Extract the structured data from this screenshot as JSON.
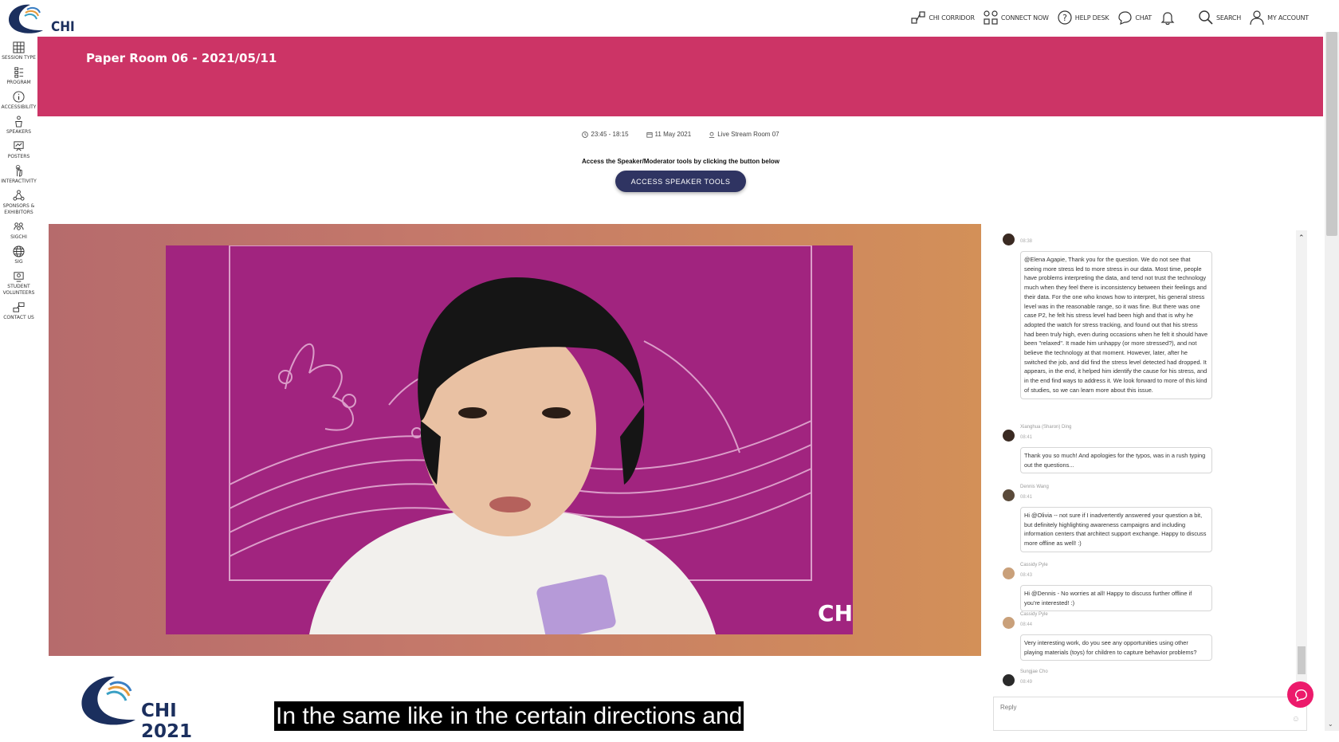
{
  "brand": {
    "logo_text": "CHI 2021"
  },
  "topnav": [
    {
      "name": "chi-corridor",
      "label": "CHI CORRIDOR",
      "icon": "corridor-icon"
    },
    {
      "name": "connect-now",
      "label": "CONNECT NOW",
      "icon": "connect-icon"
    },
    {
      "name": "help-desk",
      "label": "HELP DESK",
      "icon": "help-icon"
    },
    {
      "name": "chat",
      "label": "CHAT",
      "icon": "chat-icon"
    },
    {
      "name": "notifications",
      "label": "",
      "icon": "bell-icon"
    },
    {
      "name": "search",
      "label": "SEARCH",
      "icon": "search-icon"
    },
    {
      "name": "my-account",
      "label": "MY ACCOUNT",
      "icon": "user-icon"
    }
  ],
  "sidebar": [
    {
      "name": "session-type",
      "label": "SESSION TYPE",
      "icon": "grid-icon"
    },
    {
      "name": "program",
      "label": "PROGRAM",
      "icon": "list-icon"
    },
    {
      "name": "accessibility",
      "label": "ACCESSIBILITY",
      "icon": "info-icon"
    },
    {
      "name": "speakers",
      "label": "SPEAKERS",
      "icon": "podium-icon"
    },
    {
      "name": "posters",
      "label": "POSTERS",
      "icon": "poster-icon"
    },
    {
      "name": "interactivity",
      "label": "INTERACTIVITY",
      "icon": "hand-icon"
    },
    {
      "name": "sponsors",
      "label": "SPONSORS & EXHIBITORS",
      "icon": "network-icon"
    },
    {
      "name": "sigchi",
      "label": "SIGCHI",
      "icon": "people-icon"
    },
    {
      "name": "sig",
      "label": "SIG",
      "icon": "globe-icon"
    },
    {
      "name": "student-volunteers",
      "label": "STUDENT VOLUNTEERS",
      "icon": "volunteer-icon"
    },
    {
      "name": "contact-us",
      "label": "CONTACT US",
      "icon": "contact-icon"
    }
  ],
  "banner": {
    "title": "Paper Room 06 - 2021/05/11"
  },
  "session": {
    "time": "23:45 - 18:15",
    "date": "11 May 2021",
    "room": "Live Stream Room 07",
    "notice": "Access the Speaker/Moderator tools by clicking the button below",
    "button_label": "ACCESS SPEAKER TOOLS"
  },
  "video": {
    "brand_corner": "CH"
  },
  "caption": "In the same like in the certain directions and",
  "chat": {
    "messages": [
      {
        "who": "",
        "time": "08:38",
        "text": "@Elena Agapie,  Thank you for the question.  We do not see that seeing more stress led to more stress in our data. Most time, people have problems interpreting the data, and tend not trust the technology much when they feel there is inconsistency between their feelings and their data.  For the one who knows how to interpret,  his general stress level was in the reasonable range,  so it was fine. But there was one case P2, he felt his stress level had been high and that is why he adopted the watch for stress tracking, and found out that his stress had been truly high, even  during occasions when he felt it should have been \"relaxed\".  It made him unhappy (or more stressed?), and not believe the technology at that moment. However, later, after he switched the job, and did find the stress level detected had dropped. It appears, in the end, it helped him identify the cause for his stress, and in the end find ways to address it.  We look forward to more of this kind of studies, so we can learn more about this issue."
      },
      {
        "who": "Xianghua (Sharon) Ding",
        "time": "08:41",
        "text": "Thank you so much! And apologies for the typos, was in a rush typing out the questions..."
      },
      {
        "who": "Dennis Wang",
        "time": "08:41",
        "text": "Hi @Olivia -- not sure if I inadvertently answered your question a bit, but definitely highlighting awareness campaigns and including information centers that architect support exchange. Happy to discuss more offline as well! :)"
      },
      {
        "who": "Cassidy Pyle",
        "time": "08:43",
        "text": "Hi @Dennis - No worries at all! Happy to discuss further offline if you're interested! :)"
      },
      {
        "who": "Cassidy Pyle",
        "time": "08:44",
        "text": "Very interesting work, do you see any opportunities using other playing materials (toys) for children to capture behavior problems?"
      },
      {
        "who": "Sungjae Cho",
        "time": "08:49",
        "text": ""
      }
    ],
    "reply_placeholder": "Reply"
  },
  "colors": {
    "banner": "#cc3466",
    "button": "#2f3462",
    "fab": "#ec1a6b"
  }
}
